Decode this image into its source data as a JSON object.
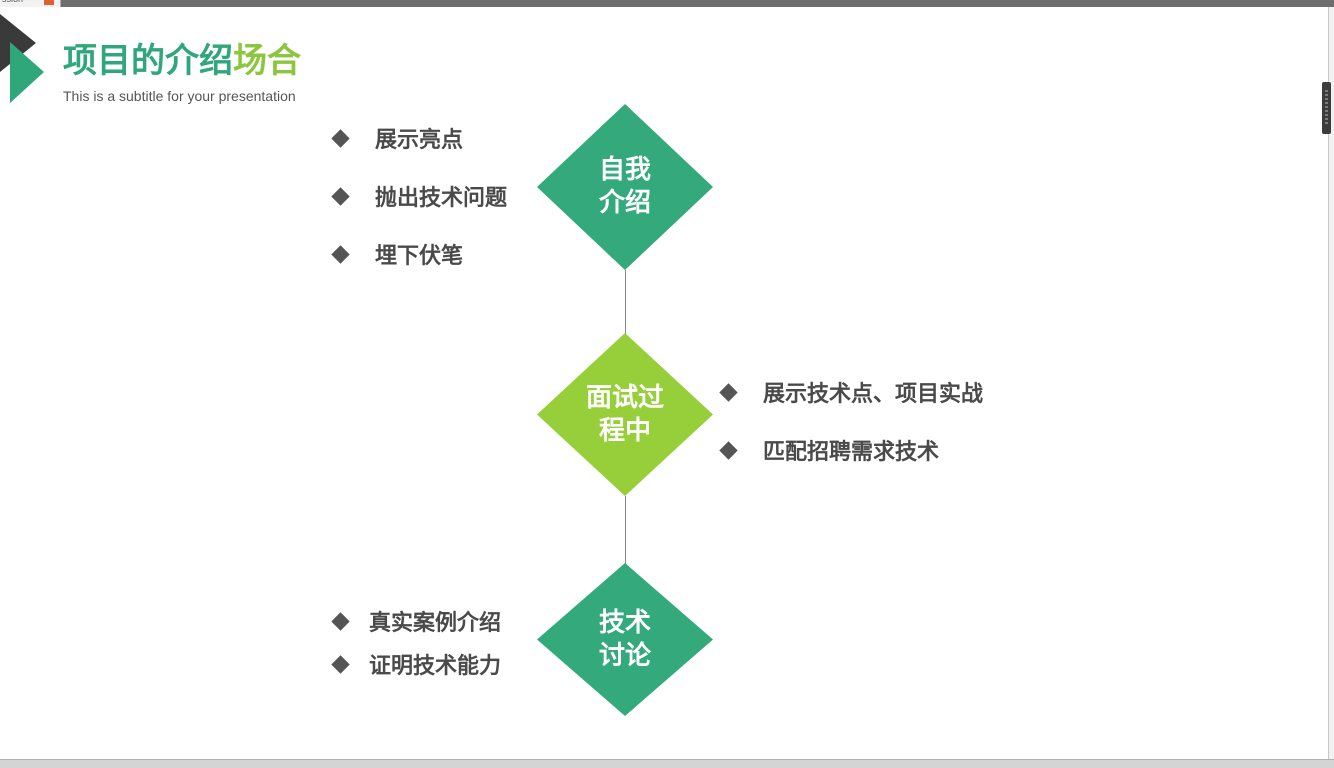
{
  "window": {
    "tab_label": "ssion"
  },
  "slide": {
    "title_part1": "项目的介绍",
    "title_part2": "场合",
    "subtitle": "This is a subtitle for your presentation",
    "colors": {
      "green": "#2fa77a",
      "lime": "#8cc63f",
      "diamond_green": "#33a97c",
      "diamond_lime": "#97cf3a",
      "text_gray": "#4a4a4a",
      "logo_dark": "#3a3a3a"
    },
    "stages": [
      {
        "line1": "自我",
        "line2": "介绍",
        "bullets": [
          "展示亮点",
          "抛出技术问题",
          "埋下伏笔"
        ]
      },
      {
        "line1": "面试过",
        "line2": "程中",
        "bullets": [
          "展示技术点、项目实战",
          "匹配招聘需求技术"
        ]
      },
      {
        "line1": "技术",
        "line2": "讨论",
        "bullets": [
          "真实案例介绍",
          "证明技术能力"
        ]
      }
    ]
  }
}
